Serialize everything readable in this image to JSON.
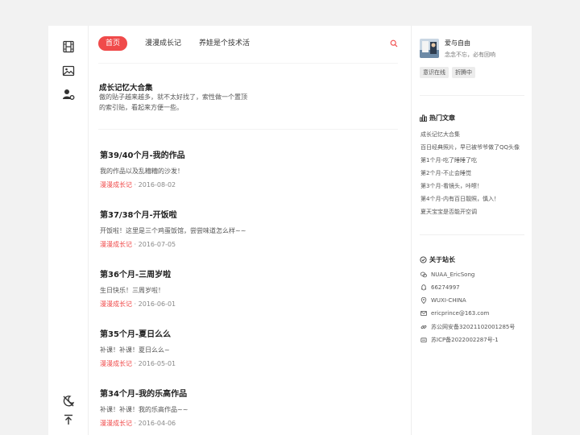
{
  "nav": {
    "tabs": [
      {
        "label": "首页",
        "active": true
      },
      {
        "label": "漫漫成长记",
        "active": false
      },
      {
        "label": "养娃是个技术活",
        "active": false
      }
    ]
  },
  "sticky": {
    "title": "成长记忆大合集",
    "description": "傲的贴子越来越多，就不太好找了，索性做一个置顶的索引贴，看起来方便一些。"
  },
  "posts": [
    {
      "title": "第39/40个月-我的作品",
      "summary": "我的作品以及乱糟糟的沙发！",
      "category": "漫漫成长记",
      "date": "2016-08-02"
    },
    {
      "title": "第37/38个月-开饭啦",
      "summary": "开饭啦！这里是三个鸡蛋饭馆，尝尝味道怎么样~~",
      "category": "漫漫成长记",
      "date": "2016-07-05"
    },
    {
      "title": "第36个月-三周岁啦",
      "summary": "生日快乐！三周岁啦！",
      "category": "漫漫成长记",
      "date": "2016-06-01"
    },
    {
      "title": "第35个月-夏日么么",
      "summary": "补课！补课！夏日么么~",
      "category": "漫漫成长记",
      "date": "2016-05-01"
    },
    {
      "title": "第34个月-我的乐高作品",
      "summary": "补课！补课！我的乐高作品~~",
      "category": "漫漫成长记",
      "date": "2016-04-06"
    }
  ],
  "meta_separator": " · ",
  "author": {
    "name": "爱与自由",
    "motto": "念念不忘，必有回响",
    "badges": [
      "意识在线",
      "折腾中"
    ]
  },
  "hot": {
    "title": "热门文章",
    "items": [
      "成长记忆大合集",
      "百日经典照片，早已被爷爷做了QQ头像",
      "第1个月-吃了睡睡了吃",
      "第2个月-不止会睡觉",
      "第3个月-看镜头，咔嚓！",
      "第4个月-内有百日靓照，慎入！",
      "夏天宝宝是否能开空调"
    ]
  },
  "about": {
    "title": "关于站长",
    "items": [
      {
        "icon": "wechat-icon",
        "text": "NUAA_EricSong"
      },
      {
        "icon": "qq-icon",
        "text": "66274997"
      },
      {
        "icon": "location-icon",
        "text": "WUXI-CHINA"
      },
      {
        "icon": "email-icon",
        "text": "ericprince@163.com"
      },
      {
        "icon": "link-icon",
        "text": "苏公网安备32021102001285号"
      },
      {
        "icon": "record-icon",
        "text": "苏ICP备2022002287号-1"
      }
    ]
  },
  "colors": {
    "accent": "#f04a4a",
    "background": "#f2f2f2",
    "panel": "#ffffff"
  },
  "leftbar_icons": [
    "film-icon",
    "image-icon",
    "user-settings-icon",
    "theme-toggle-icon",
    "back-to-top-icon"
  ]
}
